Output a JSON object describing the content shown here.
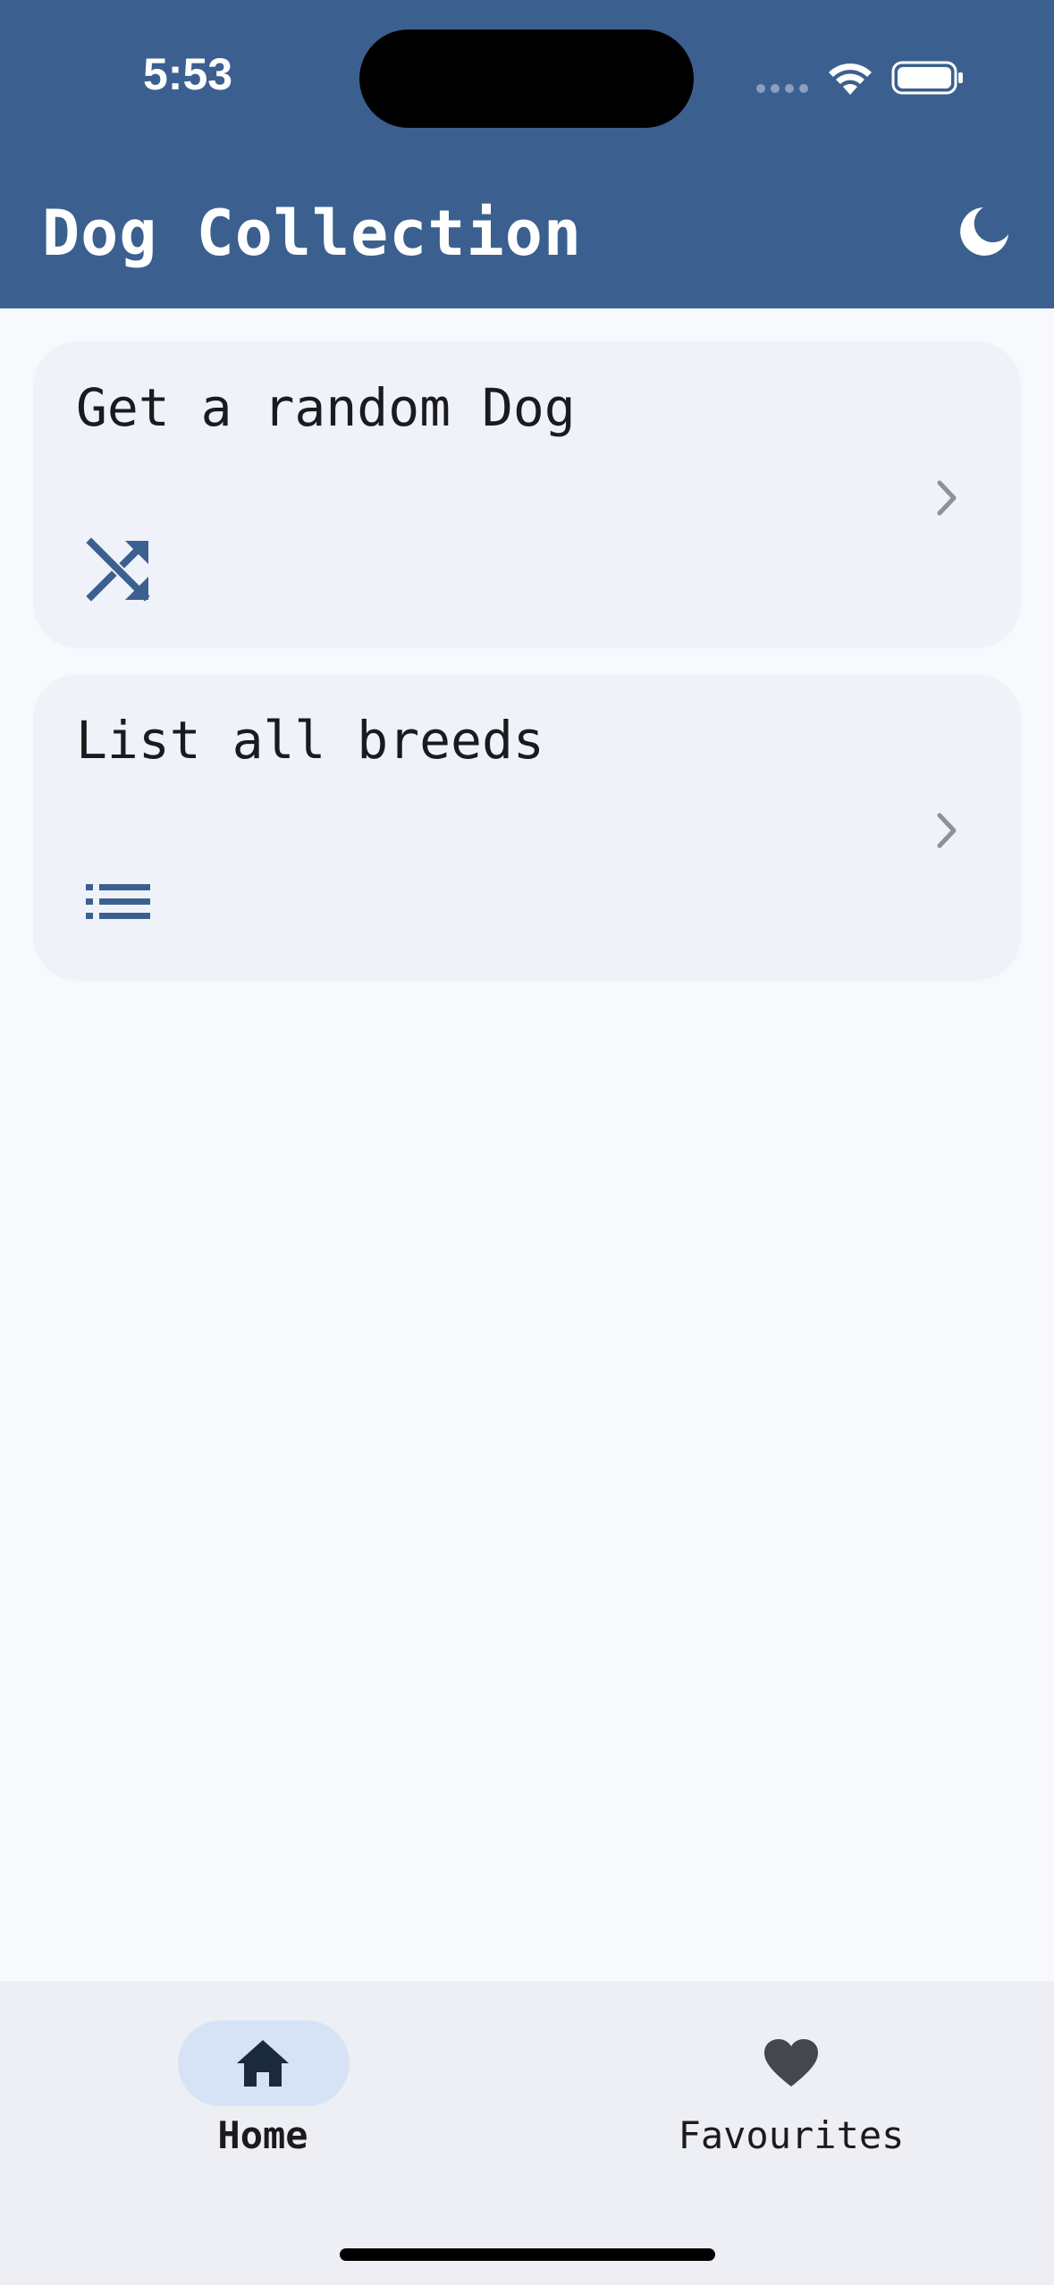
{
  "status_bar": {
    "time": "5:53"
  },
  "app_bar": {
    "title": "Dog Collection",
    "theme_icon": "moon-icon"
  },
  "cards": [
    {
      "label": "Get a random Dog",
      "icon": "shuffle-icon"
    },
    {
      "label": "List all breeds",
      "icon": "list-icon"
    }
  ],
  "bottom_nav": {
    "items": [
      {
        "label": "Home",
        "icon": "home-icon",
        "selected": true
      },
      {
        "label": "Favourites",
        "icon": "heart-icon",
        "selected": false
      }
    ]
  },
  "colors": {
    "primary": "#3b608f",
    "background": "#f7f9fd",
    "card": "#eff2f9",
    "nav_background": "#edeff4",
    "nav_indicator": "#d6e3f7"
  }
}
